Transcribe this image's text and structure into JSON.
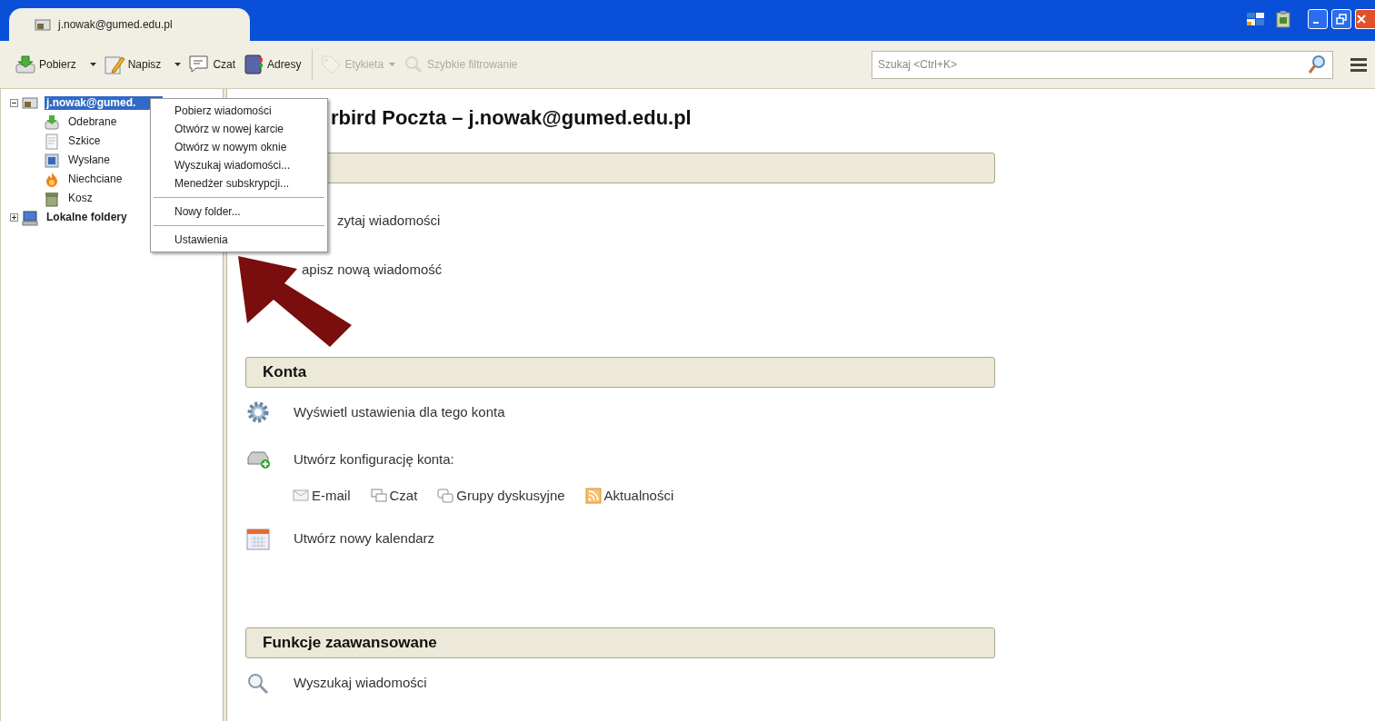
{
  "window": {
    "tab": {
      "title": "j.nowak@gumed.edu.pl",
      "selected": true
    }
  },
  "toolbar": {
    "buttons": [
      {
        "label": "Pobierz",
        "kind": "get",
        "dropdown": true,
        "disabled": false
      },
      {
        "label": "Napisz",
        "kind": "write",
        "dropdown": true,
        "disabled": false
      },
      {
        "label": "Czat",
        "kind": "chat",
        "dropdown": false,
        "disabled": false
      },
      {
        "label": "Adresy",
        "kind": "addressbook",
        "dropdown": false,
        "disabled": false
      },
      {
        "label": "Etykieta",
        "kind": "tag",
        "dropdown": true,
        "disabled": true
      },
      {
        "label": "Szybkie filtrowanie",
        "kind": "filter",
        "dropdown": false,
        "disabled": true
      }
    ],
    "search": {
      "placeholder": "Szukaj <Ctrl+K>"
    }
  },
  "folder_tree": [
    {
      "label": "j.nowak@gumed.",
      "kind": "account",
      "expanded": true,
      "selected": true,
      "children": [
        {
          "label": "Odebrane",
          "kind": "inbox",
          "selected": false
        },
        {
          "label": "Szkice",
          "kind": "drafts",
          "selected": false
        },
        {
          "label": "Wysłane",
          "kind": "sent",
          "selected": false
        },
        {
          "label": "Niechciane",
          "kind": "junk",
          "selected": false
        },
        {
          "label": "Kosz",
          "kind": "trash",
          "selected": false
        }
      ]
    },
    {
      "label": "Lokalne foldery",
      "kind": "local",
      "expanded": false,
      "selected": false
    }
  ],
  "context_menu": {
    "groups": [
      [
        {
          "label": "Pobierz wiadomości"
        },
        {
          "label": "Otwórz w nowej karcie"
        },
        {
          "label": "Otwórz w nowym oknie"
        },
        {
          "label": "Wyszukaj wiadomości..."
        },
        {
          "label": "Menedżer subskrypcji..."
        }
      ],
      [
        {
          "label": "Nowy folder..."
        }
      ],
      [
        {
          "label": "Ustawienia"
        }
      ]
    ]
  },
  "main": {
    "title": "rbird Poczta – j.nowak@gumed.edu.pl",
    "sections": [
      {
        "items": [
          {
            "kind": "read",
            "label": "zytaj wiadomości"
          },
          {
            "kind": "write",
            "label": "apisz nową wiadomość"
          }
        ]
      },
      {
        "heading": "Konta",
        "items": [
          {
            "kind": "settings",
            "label": "Wyświetl ustawienia dla tego konta"
          },
          {
            "kind": "new-account",
            "label": "Utwórz konfigurację konta:"
          },
          {
            "kind": "links",
            "links": [
              {
                "kind": "email",
                "label": "E-mail"
              },
              {
                "kind": "chat",
                "label": "Czat"
              },
              {
                "kind": "news",
                "label": "Grupy dyskusyjne"
              },
              {
                "kind": "feed",
                "label": "Aktualności"
              }
            ]
          },
          {
            "kind": "calendar",
            "label": "Utwórz nowy kalendarz"
          }
        ]
      },
      {
        "heading": "Funkcje zaawansowane",
        "items": [
          {
            "kind": "search",
            "label": "Wyszukaj wiadomości"
          }
        ]
      }
    ]
  }
}
